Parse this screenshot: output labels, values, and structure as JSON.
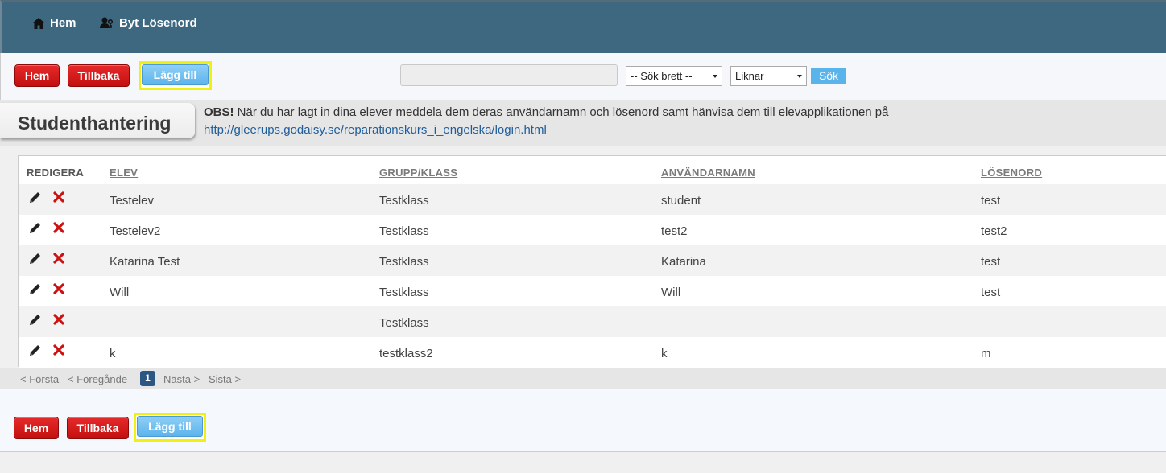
{
  "nav": {
    "home_label": "Hem",
    "password_label": "Byt Lösenord"
  },
  "toolbar": {
    "home_label": "Hem",
    "back_label": "Tillbaka",
    "add_label": "Lägg till",
    "search_value": "",
    "search_scope": "-- Sök brett --",
    "match_mode": "Liknar",
    "search_label": "Sök"
  },
  "page": {
    "title": "Studenthantering",
    "notice_bold": "OBS!",
    "notice_text": " När du har lagt in dina elever meddela dem deras användarnamn och lösenord samt hänvisa dem till elevapplikationen på",
    "notice_link": "http://gleerups.godaisy.se/reparationskurs_i_engelska/login.html"
  },
  "table": {
    "columns": [
      "REDIGERA",
      "ELEV",
      "GRUPP/KLASS",
      "ANVÄNDARNAMN",
      "LÖSENORD"
    ],
    "rows": [
      {
        "elev": "Testelev",
        "grupp": "Testklass",
        "anvandarnamn": "student",
        "losenord": "test"
      },
      {
        "elev": "Testelev2",
        "grupp": "Testklass",
        "anvandarnamn": "test2",
        "losenord": "test2"
      },
      {
        "elev": "Katarina Test",
        "grupp": "Testklass",
        "anvandarnamn": "Katarina",
        "losenord": "test"
      },
      {
        "elev": "Will",
        "grupp": "Testklass",
        "anvandarnamn": "Will",
        "losenord": "test"
      },
      {
        "elev": "",
        "grupp": "Testklass",
        "anvandarnamn": "",
        "losenord": ""
      },
      {
        "elev": "k",
        "grupp": "testklass2",
        "anvandarnamn": "k",
        "losenord": "m"
      }
    ]
  },
  "pager": {
    "first": "< Första",
    "prev": "< Föregånde",
    "current": "1",
    "next": "Nästa >",
    "last": "Sista >"
  },
  "bottom": {
    "home_label": "Hem",
    "back_label": "Tillbaka",
    "add_label": "Lägg till"
  },
  "colors": {
    "nav_bg": "#3e6880",
    "red_button": "#d41b1b",
    "blue_button": "#6cbdf0",
    "highlight_border": "#f0f012",
    "link": "#1f5d9a",
    "delete_icon": "#cc1111"
  },
  "icons": {
    "nav_home": "home-icon",
    "nav_password": "user-key-icon",
    "edit": "pencil-icon",
    "delete": "x-icon"
  }
}
